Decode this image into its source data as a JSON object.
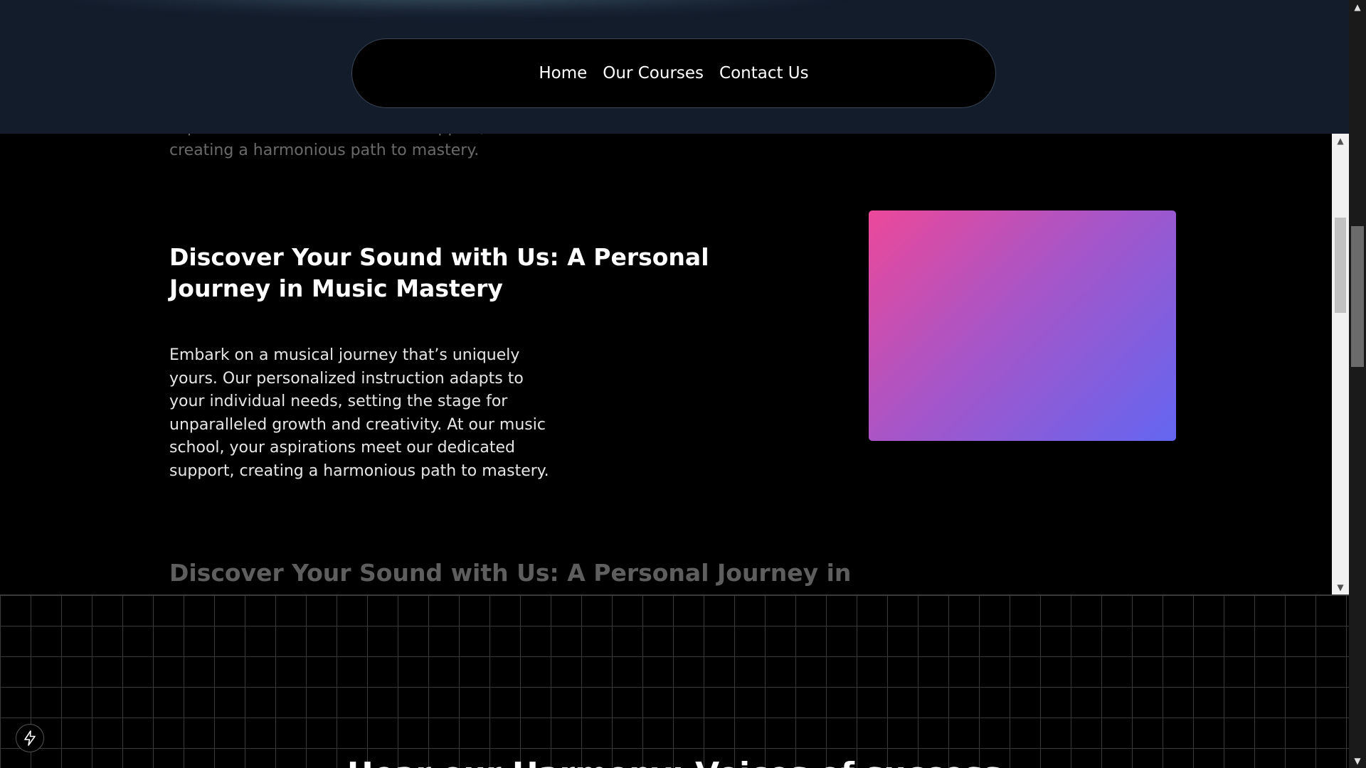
{
  "nav": {
    "items": [
      {
        "label": "Home"
      },
      {
        "label": "Our Courses"
      },
      {
        "label": "Contact Us"
      }
    ]
  },
  "sections": {
    "faded_top_lines": "aspirations meet our dedicated support, creating a harmonious path to mastery.",
    "feature": {
      "title": "Discover Your Sound with Us: A Personal Journey in Music Mastery",
      "body": "Embark on a musical journey that’s uniquely yours. Our personalized instruction adapts to your individual needs, setting the stage for unparalleled growth and creativity. At our music school, your aspirations meet our dedicated support, creating a harmonious path to mastery."
    },
    "next_title": "Discover Your Sound with Us: A Personal Journey in"
  },
  "grid_section": {
    "heading": "Hear our Harmony: Voices of success"
  },
  "scrollbar": {
    "up_icon": "triangle-up-icon",
    "down_icon": "triangle-down-icon"
  },
  "floating_button": {
    "icon": "lightning-bolt-icon"
  },
  "colors": {
    "header_band": "#131c2b",
    "gradient_start": "#ec4899",
    "gradient_end": "#6366f1"
  }
}
